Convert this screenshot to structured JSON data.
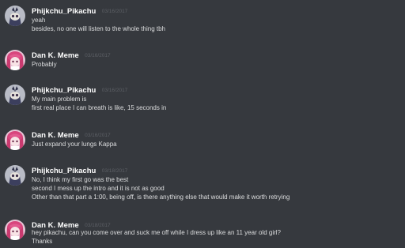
{
  "messages": [
    {
      "author": "Phijkchu_Pikachu",
      "timestamp": "03/16/2017",
      "avatar": "pikachu-avatar",
      "lines": [
        "yeah",
        "besides, no one will listen to the whole thing tbh"
      ]
    },
    {
      "author": "Dan K. Meme",
      "timestamp": "03/16/2017",
      "avatar": "anime-girl-avatar",
      "lines": [
        "Probably"
      ]
    },
    {
      "author": "Phijkchu_Pikachu",
      "timestamp": "03/16/2017",
      "avatar": "pikachu-avatar",
      "lines": [
        "My main problem is",
        "first real place I can breath is like, 15 seconds in"
      ]
    },
    {
      "author": "Dan K. Meme",
      "timestamp": "03/16/2017",
      "avatar": "anime-girl-avatar",
      "lines": [
        "Just expand your lungs Kappa"
      ]
    },
    {
      "author": "Phijkchu_Pikachu",
      "timestamp": "03/18/2017",
      "avatar": "pikachu-avatar",
      "lines": [
        "No, I think my first go was the best",
        "second I mess up the intro and it is not as good",
        "Other than that part a 1:00, being off, is there anything else that would make it worth retrying"
      ]
    },
    {
      "author": "Dan K. Meme",
      "timestamp": "03/18/2017",
      "avatar": "anime-girl-avatar",
      "lines": [
        "hey pikachu, can you come over and suck me off while I dress up like an 11 year old girl?",
        "Thanks"
      ]
    }
  ]
}
